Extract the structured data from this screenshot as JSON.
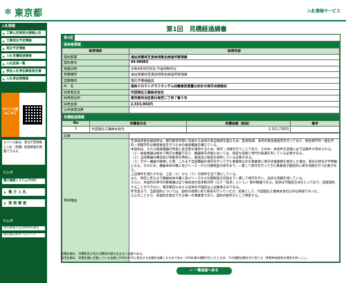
{
  "header": {
    "logo_text": "東京都",
    "title": "入札情報サービス"
  },
  "sidebar": {
    "head": "入札情報",
    "items": [
      "工事公告等発注情報公告",
      "工事発注予定情報",
      "発注予定情報",
      "入札見積経過情報",
      "入札結果一覧",
      "参加入札参加資格者名簿",
      "入札参加等情報"
    ],
    "mobile_label": "モバイル版はこちら",
    "mobile_note": "モバイル版は、発注予定情報と入札（見積）経過情報を閲覧できます。",
    "links_head": "リンク",
    "system_link": "電子調達システム(TOP)",
    "btn1": "電 子 入 札",
    "btn2": "資 格 審 査",
    "bottom_head": "リンク",
    "bottom_links": [
      "東京都電子自治体共同運営",
      "東京都公式ホームページ"
    ]
  },
  "main": {
    "title": "第1回　見積経過調書",
    "tab": "第1回",
    "section1": "採用者情報",
    "col_item": "採用項目",
    "col_content": "採用内容",
    "rows": [
      {
        "label": "契約部署",
        "value": "福祉保健局芝浦食肉衛生検査所管理課"
      },
      {
        "label": "契約番号",
        "value": "04-00065"
      },
      {
        "label": "見積日時",
        "value": "令和4年9月30日 午後5時00分"
      },
      {
        "label": "見積場所",
        "value": "福祉保健局芝浦食肉衛生検査所管理課"
      },
      {
        "label": "営業種目",
        "value": "理化学機械器具"
      },
      {
        "label": "件　名",
        "value": "液体クロマトグラフタンデム四重極型質量分析計の保守点検委託"
      },
      {
        "label": "採用者氏名",
        "value": "竹田理化工業株式会社"
      },
      {
        "label": "採用者住所",
        "value": "東京都渋谷区恵比寿西二丁目７番５号"
      },
      {
        "label": "採用金額",
        "value": "2,553,903円"
      },
      {
        "label": "公共調達加算",
        "value": ""
      }
    ],
    "section2": "見積経過情報",
    "bid_headers": [
      "No",
      "見積者氏名",
      "見積金額（税抜）",
      "備考"
    ],
    "bids": [
      {
        "no": "1",
        "name": "竹田理化工業株式会社",
        "amount": "2,321,730円",
        "note": ""
      }
    ],
    "record_label": "記事",
    "special_label": "特命理由",
    "special_text": "芝浦食肉衛生検査所は、都内卸売市場に流通する食肉の安全確保を図るため、監視指導、食肉の衛生検査等を行っており、微生物学的・理化学的・病理学的な精密検査を行うための検査機器を備えている。\n本契約は、それら検査機器の性能と安全性を維持するため、保守・点検を行うことであり、その中、本案件を実施には下記要件が求められる。\n（１）検査機器は極めて精巧な機器であり、機器保守点検においては、高度な技術と専門の知識を有している必要がある。\n（２）当該機器の構造及び性能等を熟知し、部品及び部品を保有している必要がある。\n（３）万が一機器が故障した際、これまで当該機器の保守を行ってきた事業者以外の事業者に保守点検業務を委託した場合、責任の所在が不明確となる。そのため、機器本体の購入及びリース・から付属製品の保守まで、一貫して保守を行ってきた事業者が継続的に保守点検を行う必要がある。\n上記要件を満たすのは、上記（１）から（３）の要件を全て満たしている。\nまた、現在に至るまで機器本体の購入及びリースから付属製品の交換まで一貫して保守を行い、良好な実績を残している。\nさらに、本契約の保守対象機器は全て株式会社島津製作所（以下「島津」という。）製の機器である。島津は代理店方式をとっており、直接契約することができない。東京都内における島津の代理店は上記業者のみである。\n昨年度まで、当該契約については、契約の適用に則り競争を行っていたが、結果として、竹田理化工業株式会社以外は辞退であった。\n以上のことから、本契約を発注できる唯一の事業者であり、契約の相手方として特定する。"
  },
  "notes": [
    "見積金額は、消費税及び地方消費税の額を含まない金額である。",
    "採用金額は、見積金額に記載している金額に100分の10に相当する金額を加算したものである（1円未満の端数が生じたときは、その端数金額を切り捨てる（単数単価契約の場合を除く。）。）。"
  ],
  "back_button": "← 一覧画面へ戻る",
  "colors": {
    "accent": "#0a7a3c",
    "dark": "#0a5a2c",
    "light": "#c8e6c8",
    "orange": "#f08000"
  }
}
